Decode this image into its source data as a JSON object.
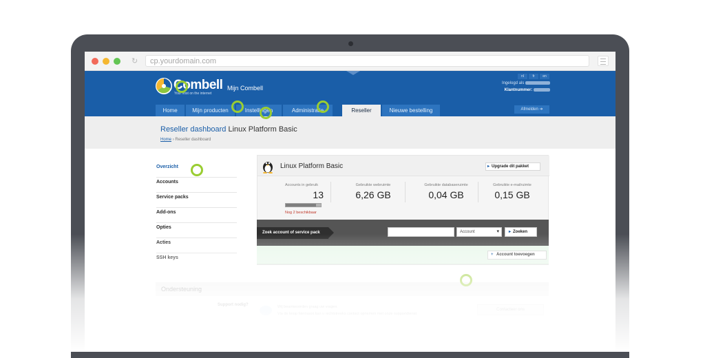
{
  "browser": {
    "url": "cp.yourdomain.com",
    "reload_glyph": "↻"
  },
  "header": {
    "logo_text": "Combell",
    "logo_tagline": "Your host on the internet",
    "section_label": "Mijn Combell",
    "languages": [
      "nl",
      "fr",
      "en"
    ],
    "logged_in_label": "Ingelogd als",
    "customer_number_label": "Klantnummer:",
    "logout_label": "Afmelden ➔"
  },
  "nav": {
    "tabs": [
      {
        "label": "Home",
        "active": false
      },
      {
        "label": "Mijn producten",
        "active": false
      },
      {
        "label": "Instellingen",
        "active": false
      },
      {
        "label": "Administratie",
        "active": false
      },
      {
        "label": "Reseller",
        "active": true
      },
      {
        "label": "Nieuwe bestelling",
        "active": false
      }
    ]
  },
  "page": {
    "title_main": "Reseller dashboard",
    "title_suffix": "Linux Platform Basic",
    "breadcrumb_home": "Home",
    "breadcrumb_separator": "›",
    "breadcrumb_current": "Reseller dashboard"
  },
  "sidebar": {
    "items": [
      {
        "label": "Overzicht",
        "active": true
      },
      {
        "label": "Accounts",
        "active": false
      },
      {
        "label": "Service packs",
        "active": false
      },
      {
        "label": "Add-ons",
        "active": false
      },
      {
        "label": "Opties",
        "active": false
      },
      {
        "label": "Acties",
        "active": false
      },
      {
        "label": "SSH keys",
        "active": false
      }
    ]
  },
  "panel": {
    "title": "Linux Platform Basic",
    "upgrade_label": "Upgrade dit pakket",
    "stats": [
      {
        "label": "Accounts in gebruik",
        "value": "13"
      },
      {
        "label": "Gebruikte webruimte",
        "value": "6,26 GB"
      },
      {
        "label": "Gebruikte databaseruimte",
        "value": "0,04 GB"
      },
      {
        "label": "Gebruikte e-mailruimte",
        "value": "0,15 GB"
      }
    ],
    "accounts_usage_fraction": 0.87,
    "available_text": "Nog 2 beschikbaar",
    "search_tag": "Zoek account of service pack",
    "search_value": "",
    "search_select_value": "Account",
    "search_button": "Zoeken",
    "add_account_label": "Account toevoegen"
  },
  "support": {
    "heading": "Ondersteuning",
    "question": "Support nodig?",
    "line1": "Wij beantwoorden graag uw vragen",
    "line2": "Via de knop hiernaast kan u rechtstreeks contact opnemen met onze supportdienst",
    "contact_label": "Contacteer ons"
  },
  "colors": {
    "brand_blue": "#1a5ea8",
    "tab_blue": "#2d74bf",
    "marker_green": "#9acd32",
    "laptop_frame": "#4b4e55"
  }
}
